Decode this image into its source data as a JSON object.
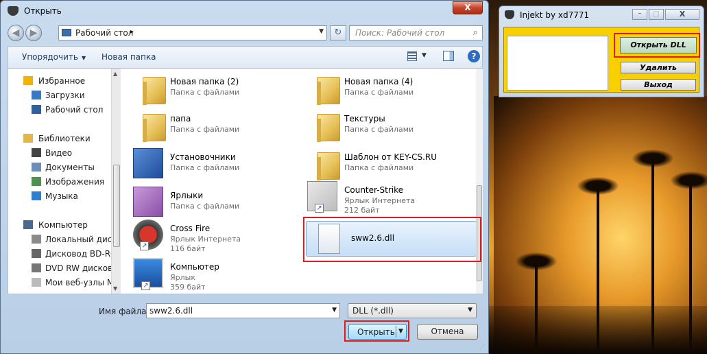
{
  "dialog": {
    "title": "Открыть",
    "close_glyph": "X"
  },
  "navbar": {
    "back_glyph": "◀",
    "forward_glyph": "▶",
    "location": "Рабочий стол",
    "separator": "▸",
    "dropdown_glyph": "▼",
    "refresh_glyph": "↻",
    "search_placeholder": "Поиск: Рабочий стол",
    "search_glyph": "⌕"
  },
  "toolbar": {
    "organize": "Упорядочить",
    "organize_caret": "▼",
    "new_folder": "Новая папка",
    "view_caret": "▼",
    "help": "?"
  },
  "sidebar": {
    "items": [
      {
        "label": "Избранное",
        "icon": "star-icon",
        "color": "#f0b400",
        "indent": false
      },
      {
        "label": "Загрузки",
        "icon": "downloads-icon",
        "color": "#3b78c2",
        "indent": true
      },
      {
        "label": "Рабочий стол",
        "icon": "desktop-icon",
        "color": "#2e5fa0",
        "indent": true
      },
      {
        "label": "Библиотеки",
        "icon": "libraries-icon",
        "color": "#e2b64a",
        "indent": false
      },
      {
        "label": "Видео",
        "icon": "video-icon",
        "color": "#444444",
        "indent": true
      },
      {
        "label": "Документы",
        "icon": "documents-icon",
        "color": "#6b8fb8",
        "indent": true
      },
      {
        "label": "Изображения",
        "icon": "pictures-icon",
        "color": "#4f8f4f",
        "indent": true
      },
      {
        "label": "Музыка",
        "icon": "music-icon",
        "color": "#2f7fd0",
        "indent": true
      },
      {
        "label": "Компьютер",
        "icon": "computer-icon",
        "color": "#4a6a90",
        "indent": false
      },
      {
        "label": "Локальный диск",
        "icon": "drive-icon",
        "color": "#8a8a8a",
        "indent": true
      },
      {
        "label": "Дисковод BD-RO",
        "icon": "bd-drive-icon",
        "color": "#666666",
        "indent": true
      },
      {
        "label": "DVD RW дисково",
        "icon": "dvd-drive-icon",
        "color": "#777777",
        "indent": true
      },
      {
        "label": "Мои веб-узлы M",
        "icon": "web-folder-icon",
        "color": "#bbbbbb",
        "indent": true
      }
    ],
    "scroll_up_glyph": "▲",
    "scroll_down_glyph": "▼"
  },
  "files": [
    {
      "name": "Новая папка (2)",
      "type": "Папка с файлами",
      "size": "",
      "icon": "folder-icon",
      "shortcut": false
    },
    {
      "name": "Новая папка (4)",
      "type": "Папка с файлами",
      "size": "",
      "icon": "folder-photoshop-icon",
      "shortcut": false
    },
    {
      "name": "папа",
      "type": "Папка с файлами",
      "size": "",
      "icon": "folder-icon",
      "shortcut": false
    },
    {
      "name": "Текстуры",
      "type": "Папка с файлами",
      "size": "",
      "icon": "folder-images-icon",
      "shortcut": false
    },
    {
      "name": "Установочники",
      "type": "Папка с файлами",
      "size": "",
      "icon": "installer-folder-icon",
      "shortcut": false
    },
    {
      "name": "Шаблон от KEY-CS.RU",
      "type": "Папка с файлами",
      "size": "",
      "icon": "folder-icon",
      "shortcut": false
    },
    {
      "name": "Ярлыки",
      "type": "Папка с файлами",
      "size": "",
      "icon": "shortcuts-folder-icon",
      "shortcut": false
    },
    {
      "name": "Counter-Strike",
      "type": "Ярлык Интернета",
      "size": "212 байт",
      "icon": "counter-strike-icon",
      "shortcut": true
    },
    {
      "name": "Cross Fire",
      "type": "Ярлык Интернета",
      "size": "116 байт",
      "icon": "crossfire-icon",
      "shortcut": true
    },
    {
      "name": "sww2.6.dll",
      "type": "",
      "size": "",
      "icon": "dll-file-icon",
      "shortcut": false,
      "selected": true
    },
    {
      "name": "Компьютер",
      "type": "Ярлык",
      "size": "359 байт",
      "icon": "computer-icon",
      "shortcut": true
    }
  ],
  "footer": {
    "filename_label": "Имя файла:",
    "filename_value": "sww2.6.dll",
    "filename_drop": "▼",
    "filter_value": "DLL (*.dll)",
    "filter_drop": "▼",
    "open_label": "Открыть",
    "open_arrow": "▼",
    "cancel_label": "Отмена",
    "grip": "⋰"
  },
  "injekt": {
    "title": "Injekt by  xd7771",
    "min_glyph": "–",
    "max_glyph": "□",
    "close_glyph": "X",
    "open_dll": "Открыть DLL",
    "remove": "Удалить",
    "exit": "Выход"
  },
  "colors": {
    "highlight": "#e01b1b",
    "injekt_panel": "#f8d000"
  }
}
